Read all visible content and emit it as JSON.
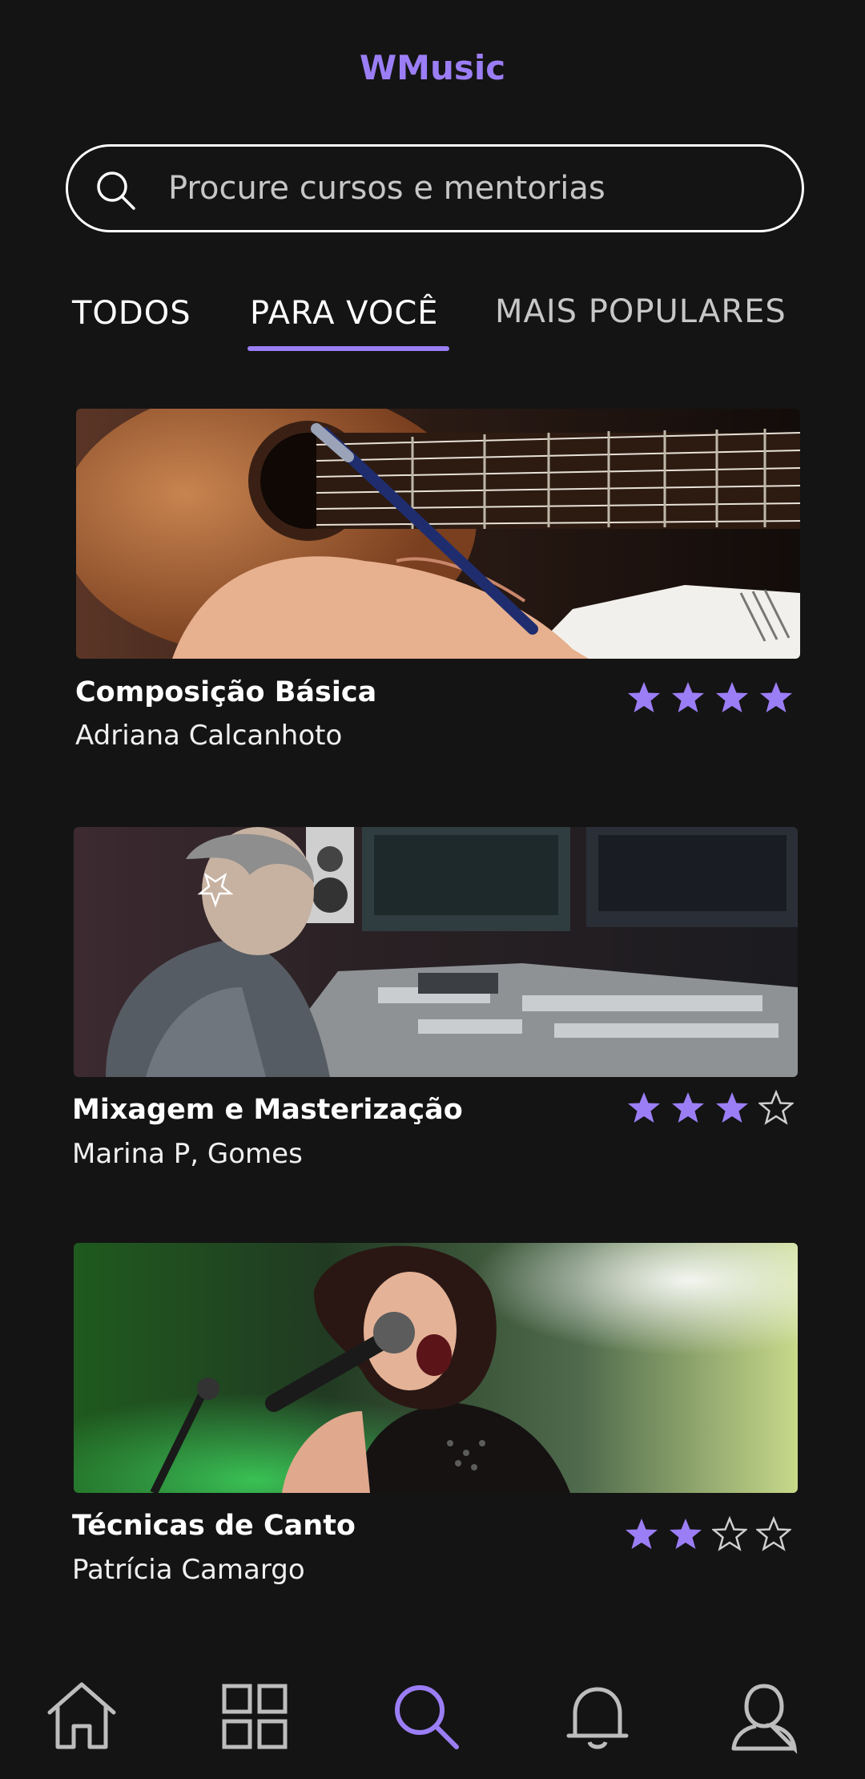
{
  "app": {
    "title": "WMusic",
    "accent": "#9b7ef5"
  },
  "search": {
    "placeholder": "Procure cursos e mentorias",
    "icon": "search-icon"
  },
  "tabs": [
    {
      "label": "TODOS",
      "active": false
    },
    {
      "label": "PARA VOCÊ",
      "active": true
    },
    {
      "label": "MAIS POPULARES",
      "active": false
    }
  ],
  "courses": [
    {
      "title": "Composição Básica",
      "author": "Adriana Calcanhoto",
      "rating": 4,
      "rating_max": 4,
      "image": "guitar-notebook-photo"
    },
    {
      "title": "Mixagem e Masterização",
      "author": "Marina P, Gomes",
      "rating": 3,
      "rating_max": 4,
      "image": "mixing-console-photo"
    },
    {
      "title": "Técnicas de Canto",
      "author": "Patrícia Camargo",
      "rating": 2,
      "rating_max": 4,
      "image": "singer-on-stage-photo"
    }
  ],
  "nav": [
    {
      "name": "home",
      "icon": "home-icon",
      "active": false
    },
    {
      "name": "catalog",
      "icon": "grid-icon",
      "active": false
    },
    {
      "name": "search",
      "icon": "search-icon",
      "active": true
    },
    {
      "name": "notifications",
      "icon": "bell-icon",
      "active": false
    },
    {
      "name": "profile",
      "icon": "user-icon",
      "active": false
    }
  ]
}
